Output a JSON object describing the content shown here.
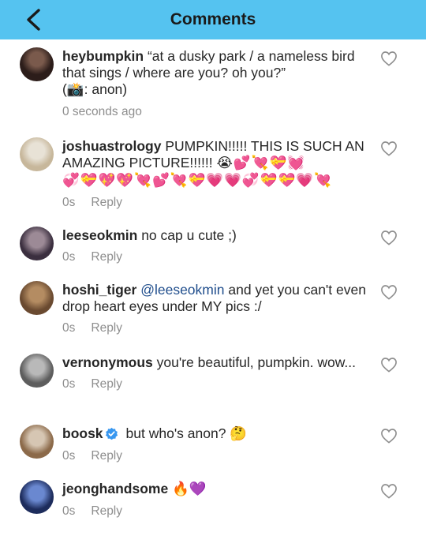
{
  "header": {
    "title": "Comments"
  },
  "comments": [
    {
      "username": "heybumpkin",
      "text": "“at a dusky park / a nameless bird that sings / where are you? oh you?”",
      "credit_open": "(",
      "credit_icon": "📸",
      "credit_text": ": anon)",
      "time": "0 seconds ago",
      "avatar_colors": [
        "#2c1d1a",
        "#7a5a4c"
      ]
    },
    {
      "username": "joshuastrology",
      "text": "PUMPKIN!!!!! THIS IS SUCH AN AMAZING PICTURE!!!!!!",
      "emoji_line1": "😭💕💘💝💓",
      "emoji_line2": "💞💝💖💖💘💕💘💝💗💗💞💝💝💗💘",
      "time": "0s",
      "reply": "Reply",
      "avatar_colors": [
        "#c7b79b",
        "#e8e2d6"
      ]
    },
    {
      "username": "leeseokmin",
      "text": "no cap u cute ;)",
      "time": "0s",
      "reply": "Reply",
      "avatar_colors": [
        "#3b2f3f",
        "#9c8a96"
      ]
    },
    {
      "username": "hoshi_tiger",
      "mention": "@leeseokmin",
      "text": "and yet you can't even drop heart eyes under MY pics :/",
      "time": "0s",
      "reply": "Reply",
      "avatar_colors": [
        "#6a4a30",
        "#b48c62"
      ]
    },
    {
      "username": "vernonymous",
      "text": "you're beautiful, pumpkin. wow...",
      "time": "0s",
      "reply": "Reply",
      "avatar_colors": [
        "#5d5d5d",
        "#b9b9b9"
      ]
    },
    {
      "username": "boosk",
      "text": "but who's anon?",
      "emoji": "🤔",
      "time": "0s",
      "reply": "Reply",
      "avatar_colors": [
        "#8c6a4a",
        "#d6c6b3"
      ]
    },
    {
      "username": "jeonghandsome",
      "emoji": "🔥💜",
      "time": "0s",
      "reply": "Reply",
      "avatar_colors": [
        "#1d2c5c",
        "#6a88d0"
      ]
    }
  ],
  "colors": {
    "header_bg": "#55c3f0",
    "text": "#262626",
    "meta": "#8e8e8e",
    "mention": "#1f4d8c",
    "verified": "#3897f0"
  }
}
